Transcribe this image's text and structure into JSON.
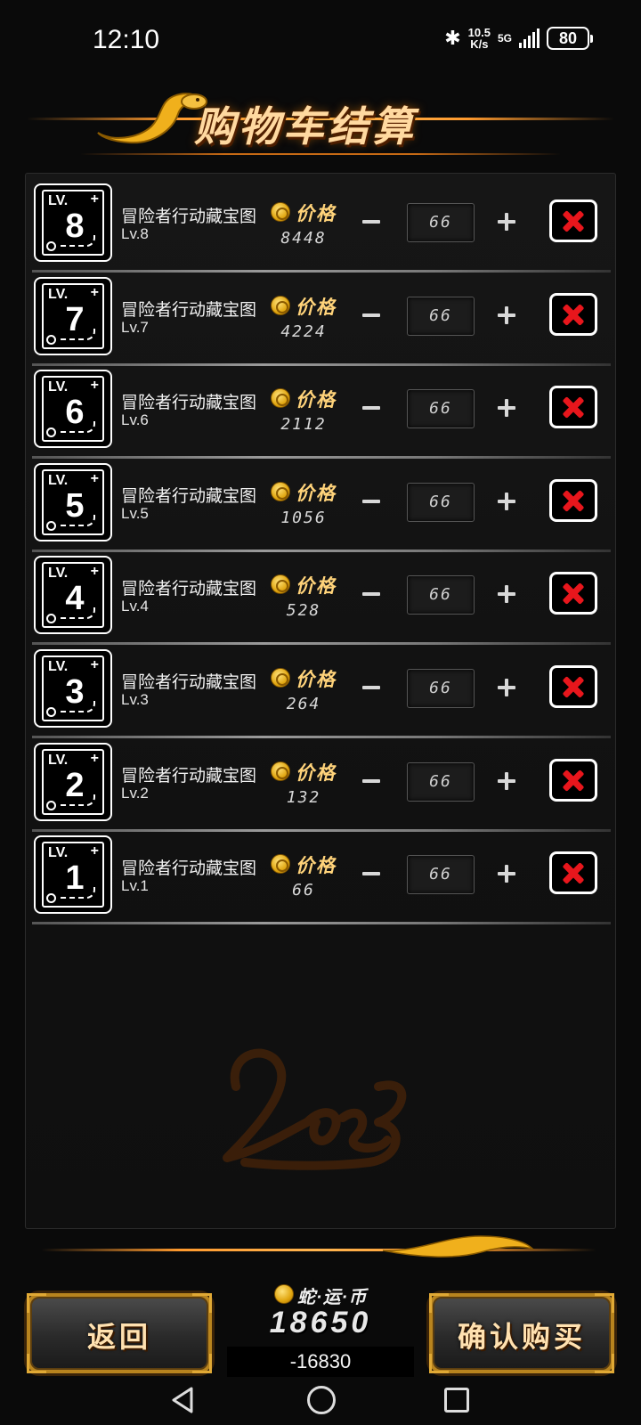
{
  "status_bar": {
    "time": "12:10",
    "speed_value": "10.5",
    "speed_unit": "K/s",
    "network": "5G",
    "battery": "80"
  },
  "header": {
    "title": "购物车结算"
  },
  "cart": {
    "price_label": "价格",
    "items": [
      {
        "level_num": "8",
        "name": "冒险者行动藏宝图",
        "level": "Lv.8",
        "price": "8448",
        "quantity": "66"
      },
      {
        "level_num": "7",
        "name": "冒险者行动藏宝图",
        "level": "Lv.7",
        "price": "4224",
        "quantity": "66"
      },
      {
        "level_num": "6",
        "name": "冒险者行动藏宝图",
        "level": "Lv.6",
        "price": "2112",
        "quantity": "66"
      },
      {
        "level_num": "5",
        "name": "冒险者行动藏宝图",
        "level": "Lv.5",
        "price": "1056",
        "quantity": "66"
      },
      {
        "level_num": "4",
        "name": "冒险者行动藏宝图",
        "level": "Lv.4",
        "price": "528",
        "quantity": "66"
      },
      {
        "level_num": "3",
        "name": "冒险者行动藏宝图",
        "level": "Lv.3",
        "price": "264",
        "quantity": "66"
      },
      {
        "level_num": "2",
        "name": "冒险者行动藏宝图",
        "level": "Lv.2",
        "price": "132",
        "quantity": "66"
      },
      {
        "level_num": "1",
        "name": "冒险者行动藏宝图",
        "level": "Lv.1",
        "price": "66",
        "quantity": "66"
      }
    ],
    "level_badge_prefix": "LV."
  },
  "footer": {
    "back_label": "返回",
    "confirm_label": "确认购买",
    "currency_name": "蛇·运·币",
    "currency_balance": "18650",
    "currency_delta": "-16830"
  },
  "colors": {
    "accent_orange": "#ff9a2e",
    "delete_red": "#e8161c",
    "gold": "#ffd37a"
  }
}
